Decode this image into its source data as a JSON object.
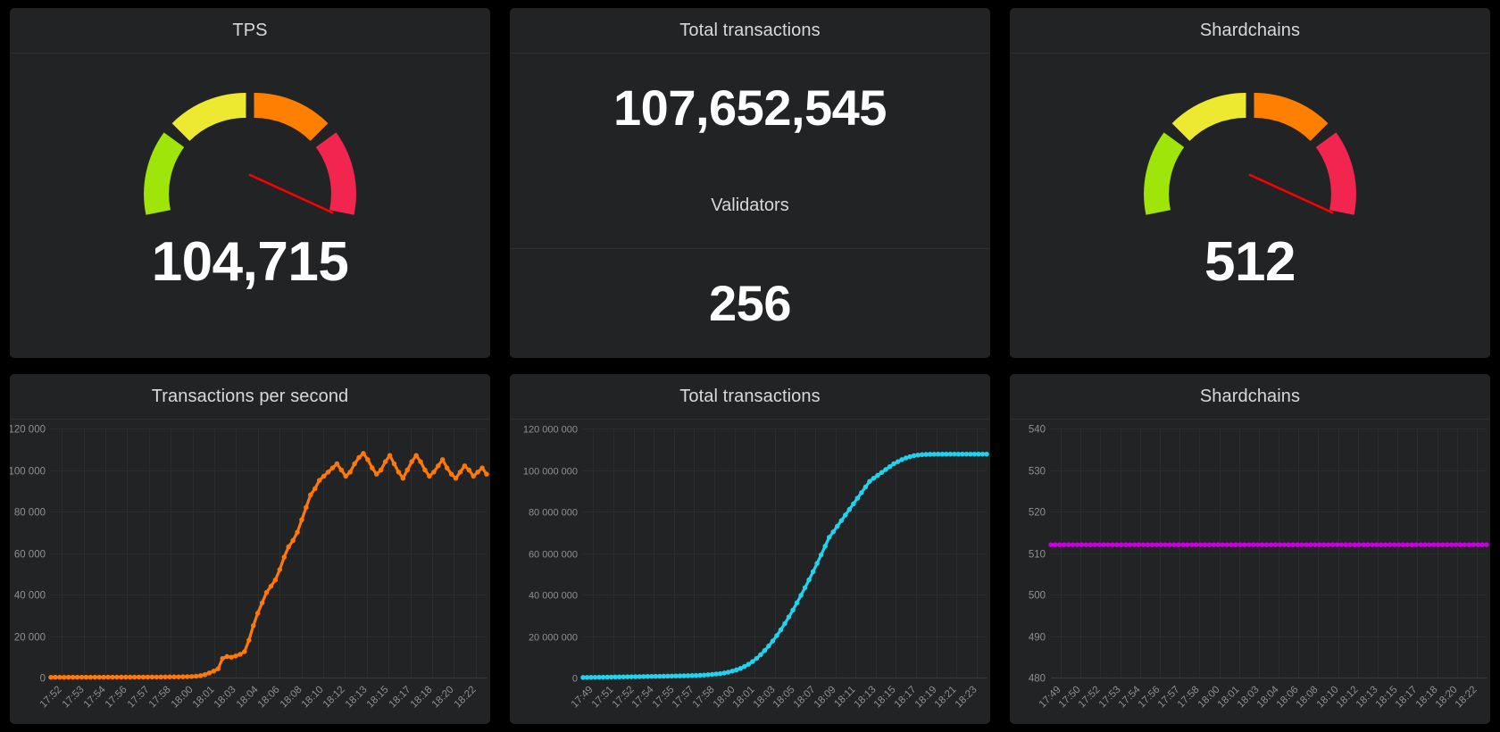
{
  "theme": {
    "page_bg": "#000000",
    "panel_bg": "#222324",
    "title_color": "#d8d9da",
    "value_color": "#ffffff",
    "grid_color": "#2c2d2e",
    "tick_color": "#8e9091",
    "series_orange": "#ff780a",
    "series_cyan": "#22d3ee",
    "series_magenta": "#c800de",
    "gauge_green": "#9fe50a",
    "gauge_yellow": "#ece930",
    "gauge_orange": "#ff8000",
    "gauge_red": "#f2254f",
    "gauge_needle": "#ff0000"
  },
  "panels": {
    "tps_gauge": {
      "title": "TPS",
      "value_label": "104,715",
      "value": 104715,
      "min": 0,
      "max": 120000,
      "needle_angle_deg": 68
    },
    "total_transactions_stat": {
      "title": "Total transactions",
      "value_label": "107,652,545",
      "value": 107652545,
      "sub_label": "Validators",
      "sub_value_label": "256",
      "sub_value": 256
    },
    "shardchains_gauge": {
      "title": "Shardchains",
      "value_label": "512",
      "value": 512,
      "min": 0,
      "max": 600,
      "needle_angle_deg": 68
    }
  },
  "chart_data": [
    {
      "id": "transactions-per-second",
      "type": "line",
      "title": "Transactions per second",
      "xlabel": "",
      "ylabel": "",
      "legend": "hidden",
      "grid": true,
      "color": "#ff780a",
      "ylim": [
        0,
        120000
      ],
      "yticks": [
        0,
        20000,
        40000,
        60000,
        80000,
        100000,
        120000
      ],
      "ytick_labels": [
        "0",
        "20 000",
        "40 000",
        "60 000",
        "80 000",
        "100 000",
        "120 000"
      ],
      "xtick_labels": [
        "17:52",
        "17:53",
        "17:54",
        "17:56",
        "17:57",
        "17:58",
        "18:00",
        "18:01",
        "18:03",
        "18:04",
        "18:06",
        "18:08",
        "18:10",
        "18:12",
        "18:13",
        "18:15",
        "18:17",
        "18:18",
        "18:20",
        "18:22"
      ],
      "x": [
        0,
        1,
        2,
        3,
        4,
        5,
        6,
        7,
        8,
        9,
        10,
        11,
        12,
        13,
        14,
        15,
        16,
        17,
        18,
        19,
        20,
        21,
        22,
        23,
        24,
        25,
        26,
        27,
        28,
        29,
        30,
        31,
        32,
        33,
        34,
        35,
        36,
        37,
        38,
        39,
        40,
        41,
        42,
        43,
        44,
        45,
        46,
        47,
        48,
        49,
        50,
        51,
        52,
        53,
        54,
        55,
        56,
        57,
        58,
        59,
        60,
        61,
        62,
        63,
        64,
        65,
        66,
        67,
        68,
        69,
        70,
        71,
        72,
        73,
        74,
        75,
        76,
        77,
        78,
        79,
        80,
        81,
        82,
        83,
        84,
        85,
        86,
        87,
        88,
        89,
        90,
        91,
        92,
        93,
        94,
        95,
        96,
        97,
        98,
        99
      ],
      "values": [
        120,
        140,
        150,
        130,
        160,
        140,
        150,
        170,
        160,
        150,
        180,
        170,
        160,
        190,
        180,
        170,
        200,
        190,
        210,
        200,
        220,
        210,
        230,
        250,
        240,
        260,
        280,
        300,
        320,
        340,
        380,
        420,
        500,
        620,
        900,
        1400,
        2200,
        3100,
        4200,
        9200,
        10100,
        9800,
        10400,
        11200,
        12500,
        18000,
        25000,
        31000,
        36000,
        41000,
        44000,
        47000,
        52000,
        58000,
        63000,
        66000,
        70000,
        76000,
        82000,
        88000,
        91000,
        95000,
        97000,
        99000,
        101000,
        103000,
        100000,
        97000,
        99000,
        103000,
        106000,
        108000,
        105000,
        101000,
        98000,
        100000,
        104000,
        107000,
        103000,
        99000,
        96000,
        100000,
        104000,
        107000,
        104000,
        100000,
        97000,
        99000,
        102000,
        105000,
        101000,
        98000,
        96000,
        99000,
        102000,
        100000,
        97000,
        99000,
        101000,
        98000
      ]
    },
    {
      "id": "total-transactions",
      "type": "line",
      "title": "Total transactions",
      "xlabel": "",
      "ylabel": "",
      "legend": "hidden",
      "grid": true,
      "color": "#22d3ee",
      "ylim": [
        0,
        120000000
      ],
      "yticks": [
        0,
        20000000,
        40000000,
        60000000,
        80000000,
        100000000,
        120000000
      ],
      "ytick_labels": [
        "0",
        "20 000 000",
        "40 000 000",
        "60 000 000",
        "80 000 000",
        "100 000 000",
        "120 000 000"
      ],
      "xtick_labels": [
        "17:49",
        "17:51",
        "17:52",
        "17:54",
        "17:55",
        "17:57",
        "17:58",
        "18:00",
        "18:01",
        "18:03",
        "18:05",
        "18:07",
        "18:09",
        "18:11",
        "18:13",
        "18:15",
        "18:17",
        "18:19",
        "18:21",
        "18:23"
      ],
      "x": [
        0,
        1,
        2,
        3,
        4,
        5,
        6,
        7,
        8,
        9,
        10,
        11,
        12,
        13,
        14,
        15,
        16,
        17,
        18,
        19,
        20,
        21,
        22,
        23,
        24,
        25,
        26,
        27,
        28,
        29,
        30,
        31,
        32,
        33,
        34,
        35,
        36,
        37,
        38,
        39,
        40,
        41,
        42,
        43,
        44,
        45,
        46,
        47,
        48,
        49,
        50,
        51,
        52,
        53,
        54,
        55,
        56,
        57,
        58,
        59,
        60,
        61,
        62,
        63,
        64,
        65,
        66,
        67,
        68,
        69,
        70,
        71,
        72,
        73,
        74,
        75,
        76,
        77,
        78,
        79,
        80,
        81,
        82,
        83,
        84,
        85,
        86,
        87,
        88,
        89,
        90,
        91,
        92,
        93,
        94,
        95,
        96,
        97,
        98,
        99
      ],
      "values": [
        30000,
        60000,
        90000,
        120000,
        150000,
        180000,
        210000,
        240000,
        270000,
        300000,
        330000,
        360000,
        390000,
        420000,
        450000,
        480000,
        510000,
        540000,
        570000,
        600000,
        640000,
        680000,
        720000,
        760000,
        800000,
        850000,
        900000,
        950000,
        1000000,
        1100000,
        1200000,
        1350000,
        1500000,
        1700000,
        1900000,
        2200000,
        2600000,
        3100000,
        3700000,
        4400000,
        5300000,
        6400000,
        7700000,
        9200000,
        11000000,
        13000000,
        15200000,
        17600000,
        20200000,
        23000000,
        26000000,
        29200000,
        32500000,
        36000000,
        39600000,
        43300000,
        47100000,
        51000000,
        55000000,
        59100000,
        63300000,
        67600000,
        70200000,
        72900000,
        75600000,
        78300000,
        81000000,
        83700000,
        86400000,
        89100000,
        91800000,
        94500000,
        96000000,
        97400000,
        98800000,
        100200000,
        101600000,
        103000000,
        104000000,
        105000000,
        105800000,
        106400000,
        106900000,
        107200000,
        107400000,
        107500000,
        107560000,
        107600000,
        107620000,
        107635000,
        107645000,
        107650000,
        107651000,
        107652000,
        107652200,
        107652350,
        107652450,
        107652500,
        107652520,
        107652540,
        107652545
      ]
    },
    {
      "id": "shardchains",
      "type": "line",
      "title": "Shardchains",
      "xlabel": "",
      "ylabel": "",
      "legend": "hidden",
      "grid": true,
      "color": "#c800de",
      "ylim": [
        480,
        540
      ],
      "yticks": [
        480,
        490,
        500,
        510,
        520,
        530,
        540
      ],
      "ytick_labels": [
        "480",
        "490",
        "500",
        "510",
        "520",
        "530",
        "540"
      ],
      "xtick_labels": [
        "17:49",
        "17:50",
        "17:52",
        "17:53",
        "17:54",
        "17:56",
        "17:57",
        "17:58",
        "18:00",
        "18:01",
        "18:03",
        "18:04",
        "18:06",
        "18:08",
        "18:10",
        "18:12",
        "18:13",
        "18:15",
        "18:17",
        "18:18",
        "18:20",
        "18:22"
      ],
      "x": [
        0,
        1,
        2,
        3,
        4,
        5,
        6,
        7,
        8,
        9,
        10,
        11,
        12,
        13,
        14,
        15,
        16,
        17,
        18,
        19,
        20,
        21,
        22,
        23,
        24,
        25,
        26,
        27,
        28,
        29,
        30,
        31,
        32,
        33,
        34,
        35,
        36,
        37,
        38,
        39,
        40,
        41,
        42,
        43,
        44,
        45,
        46,
        47,
        48,
        49,
        50,
        51,
        52,
        53,
        54,
        55,
        56,
        57,
        58,
        59,
        60,
        61,
        62,
        63,
        64,
        65,
        66,
        67,
        68,
        69,
        70,
        71,
        72,
        73,
        74,
        75,
        76,
        77,
        78,
        79,
        80,
        81,
        82,
        83,
        84,
        85,
        86,
        87,
        88,
        89,
        90,
        91,
        92,
        93,
        94,
        95,
        96,
        97,
        98,
        99
      ],
      "values": [
        512,
        512,
        512,
        512,
        512,
        512,
        512,
        512,
        512,
        512,
        512,
        512,
        512,
        512,
        512,
        512,
        512,
        512,
        512,
        512,
        512,
        512,
        512,
        512,
        512,
        512,
        512,
        512,
        512,
        512,
        512,
        512,
        512,
        512,
        512,
        512,
        512,
        512,
        512,
        512,
        512,
        512,
        512,
        512,
        512,
        512,
        512,
        512,
        512,
        512,
        512,
        512,
        512,
        512,
        512,
        512,
        512,
        512,
        512,
        512,
        512,
        512,
        512,
        512,
        512,
        512,
        512,
        512,
        512,
        512,
        512,
        512,
        512,
        512,
        512,
        512,
        512,
        512,
        512,
        512,
        512,
        512,
        512,
        512,
        512,
        512,
        512,
        512,
        512,
        512,
        512,
        512,
        512,
        512,
        512,
        512,
        512,
        512,
        512,
        512
      ]
    }
  ]
}
